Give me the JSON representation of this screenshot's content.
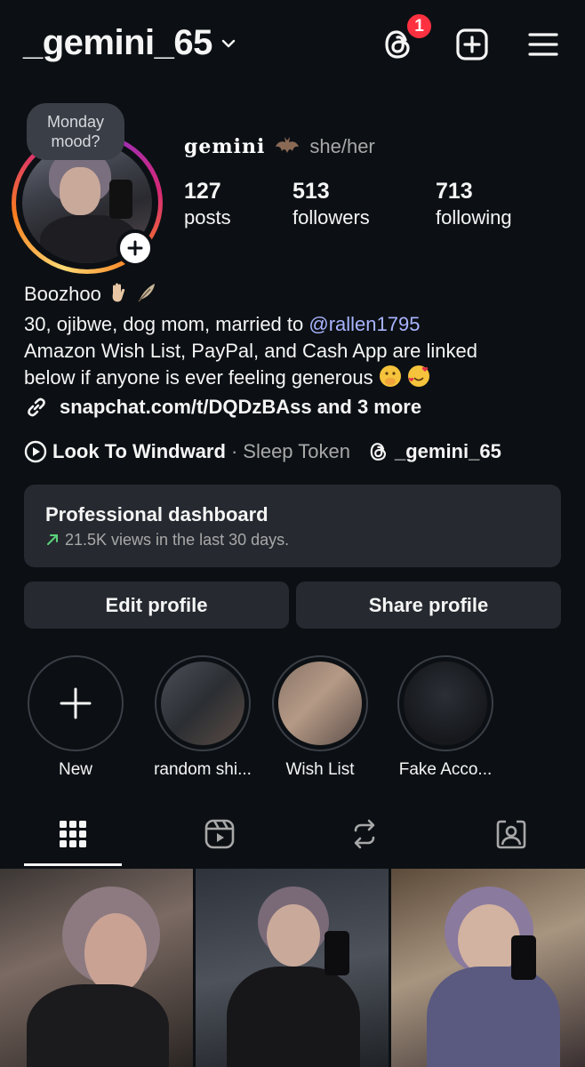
{
  "header": {
    "username": "_gemini_65",
    "threads_badge_count": "1"
  },
  "note": {
    "text": "Monday mood?"
  },
  "profile": {
    "display_name": "𝐠𝐞𝐦𝐢𝐧𝐢",
    "pronouns": "she/her",
    "stats": {
      "posts": {
        "value": "127",
        "label": "posts"
      },
      "followers": {
        "value": "513",
        "label": "followers"
      },
      "following": {
        "value": "713",
        "label": "following"
      }
    }
  },
  "bio": {
    "line1": "Boozhoo",
    "line2_prefix": "30, ojibwe, dog mom, married to ",
    "mention": "@rallen1795",
    "line3": "Amazon Wish List, PayPal, and Cash App are linked",
    "line4": "below if anyone is ever feeling generous",
    "link": "snapchat.com/t/DQDzBAss and 3 more"
  },
  "music": {
    "song": "Look To Windward",
    "separator": "·",
    "artist": "Sleep Token",
    "threads_handle": "_gemini_65"
  },
  "dashboard": {
    "title": "Professional dashboard",
    "subtitle": "21.5K views in the last 30 days."
  },
  "buttons": {
    "edit": "Edit profile",
    "share": "Share profile"
  },
  "highlights": [
    {
      "label": "New"
    },
    {
      "label": "random shi..."
    },
    {
      "label": "Wish List"
    },
    {
      "label": "Fake Acco..."
    }
  ],
  "tabs": [
    "grid-icon",
    "reels-icon",
    "reposts-icon",
    "tagged-icon"
  ],
  "colors": {
    "background": "#0c1014",
    "surface": "#262a30",
    "mention": "#a9b4ff",
    "badge": "#ff3040",
    "trend_up": "#5ad27a"
  }
}
